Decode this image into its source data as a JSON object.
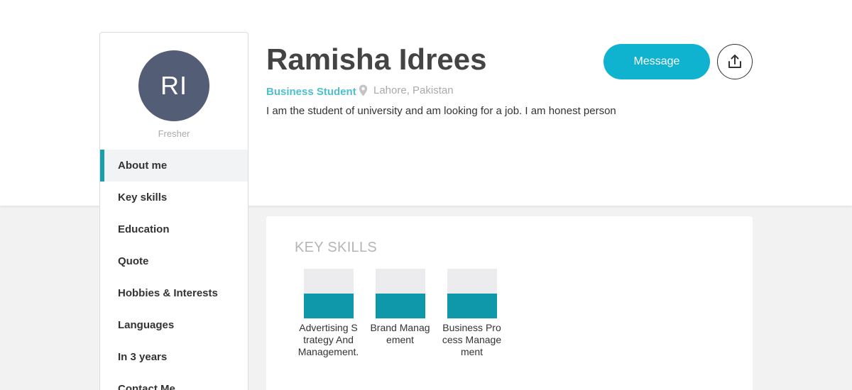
{
  "profile": {
    "initials": "RI",
    "level": "Fresher",
    "name": "Ramisha Idrees",
    "role": "Business Student",
    "location": "Lahore, Pakistan",
    "bio": "I am the student of university and am looking for a job. I am honest person"
  },
  "actions": {
    "message_label": "Message",
    "share_icon": "share-upload-icon"
  },
  "sidebar": {
    "items": [
      {
        "label": "About me",
        "active": true
      },
      {
        "label": "Key skills"
      },
      {
        "label": "Education"
      },
      {
        "label": "Quote"
      },
      {
        "label": "Hobbies & Interests"
      },
      {
        "label": "Languages"
      },
      {
        "label": "In 3 years"
      },
      {
        "label": "Contact Me"
      }
    ]
  },
  "key_skills": {
    "title": "KEY SKILLS",
    "skills": [
      {
        "name": "Advertising Strategy And Management.",
        "level": 0.5
      },
      {
        "name": "Brand Management",
        "level": 0.5
      },
      {
        "name": "Business Process Management",
        "level": 0.5
      }
    ]
  },
  "colors": {
    "accent": "#10b3cf",
    "skill_fill": "#0f98aa",
    "avatar_bg": "#535d75",
    "role_text": "#4ebfd0"
  }
}
